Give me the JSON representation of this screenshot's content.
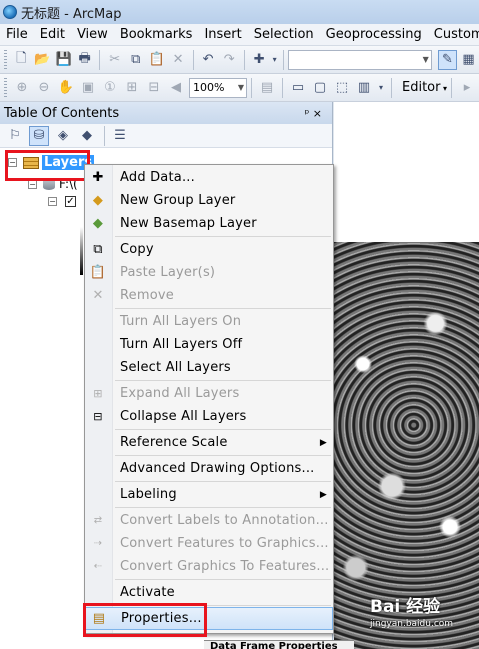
{
  "window": {
    "title": "无标题 - ArcMap"
  },
  "menubar": [
    "File",
    "Edit",
    "View",
    "Bookmarks",
    "Insert",
    "Selection",
    "Geoprocessing",
    "Customi"
  ],
  "toolbar": {
    "zoom_value": "100%",
    "editor_label": "Editor"
  },
  "toc": {
    "title": "Table Of Contents",
    "pin_glyph": "ᵖ ×",
    "root_label": "Layers",
    "child_label": "F:\\("
  },
  "context_menu": {
    "items": [
      {
        "label": "Add Data...",
        "icon": "add-data-icon",
        "enabled": true
      },
      {
        "label": "New Group Layer",
        "icon": "group-layer-icon",
        "enabled": true
      },
      {
        "label": "New Basemap Layer",
        "icon": "basemap-layer-icon",
        "enabled": true
      },
      {
        "label": "Copy",
        "icon": "copy-icon",
        "enabled": true
      },
      {
        "label": "Paste Layer(s)",
        "icon": "paste-icon",
        "enabled": false
      },
      {
        "label": "Remove",
        "icon": "remove-icon",
        "enabled": false
      },
      {
        "label": "Turn All Layers On",
        "icon": "",
        "enabled": false
      },
      {
        "label": "Turn All Layers Off",
        "icon": "",
        "enabled": true
      },
      {
        "label": "Select All Layers",
        "icon": "",
        "enabled": true
      },
      {
        "label": "Expand All Layers",
        "icon": "expand-icon",
        "enabled": false
      },
      {
        "label": "Collapse All Layers",
        "icon": "collapse-icon",
        "enabled": true
      },
      {
        "label": "Reference Scale",
        "icon": "",
        "enabled": true,
        "submenu": true
      },
      {
        "label": "Advanced Drawing Options...",
        "icon": "",
        "enabled": true
      },
      {
        "label": "Labeling",
        "icon": "",
        "enabled": true,
        "submenu": true
      },
      {
        "label": "Convert Labels to Annotation...",
        "icon": "convert-labels-icon",
        "enabled": false
      },
      {
        "label": "Convert Features to Graphics...",
        "icon": "convert-features-icon",
        "enabled": false
      },
      {
        "label": "Convert Graphics To Features...",
        "icon": "convert-graphics-icon",
        "enabled": false
      },
      {
        "label": "Activate",
        "icon": "",
        "enabled": true
      },
      {
        "label": "Properties...",
        "icon": "properties-icon",
        "enabled": true,
        "highlighted": true
      }
    ]
  },
  "bottom_strip_label": "Data Frame Properties",
  "watermark": {
    "main": "Bai 经验",
    "sub": "jingyan.baidu.com"
  },
  "colors": {
    "highlight_box": "#e8141e",
    "selection": "#3399ff"
  }
}
